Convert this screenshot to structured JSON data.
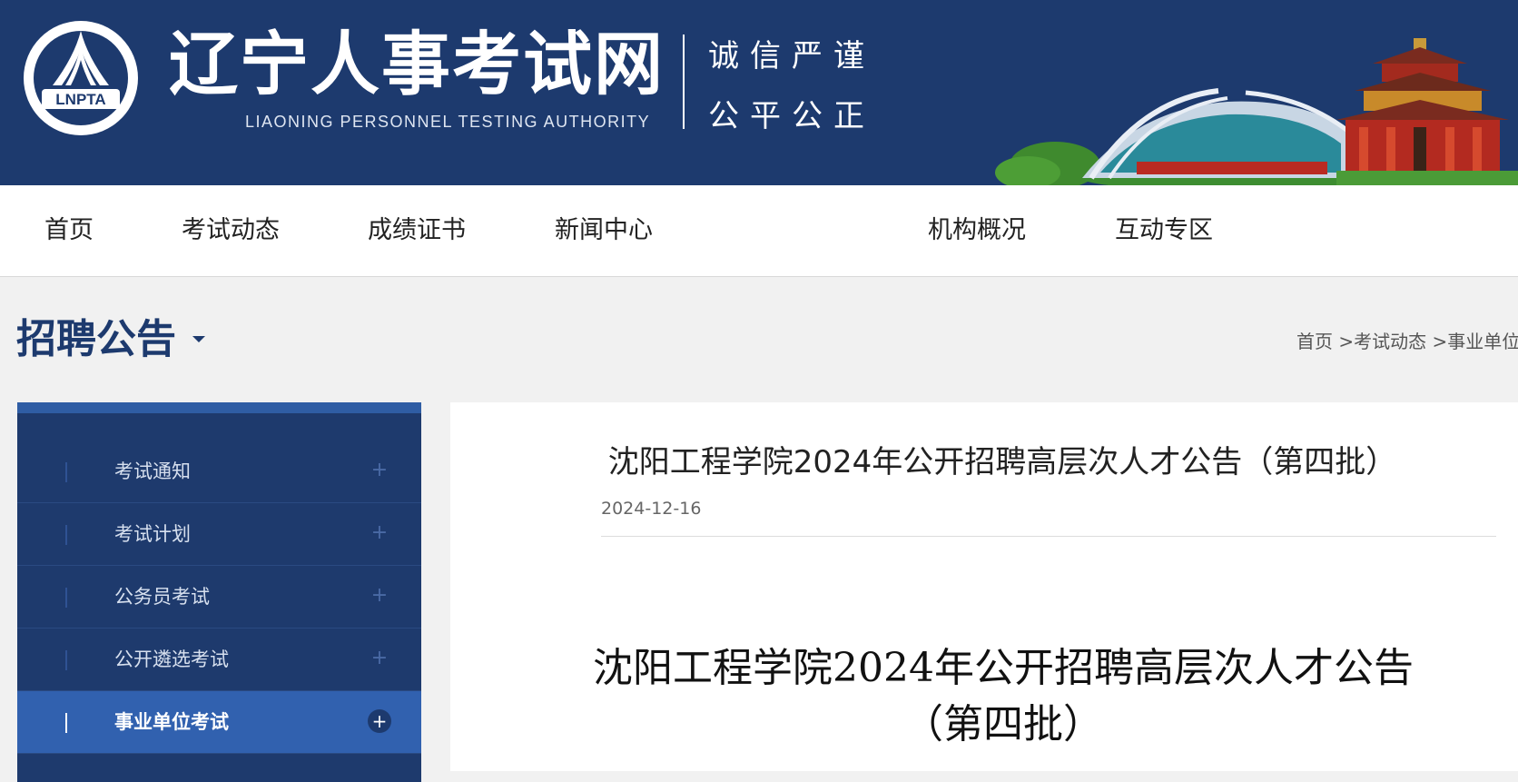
{
  "header": {
    "logo_text": "LNPTA",
    "site_title": "辽宁人事考试网",
    "site_subtitle": "LIAONING PERSONNEL TESTING AUTHORITY",
    "slogan_line1": "诚信严谨",
    "slogan_line2": "公平公正",
    "colors": {
      "banner_bg": "#1d3a6e",
      "text": "#ffffff"
    }
  },
  "nav": {
    "items": [
      {
        "label": "首页"
      },
      {
        "label": "考试动态"
      },
      {
        "label": "成绩证书"
      },
      {
        "label": "新闻中心"
      },
      {
        "label": "机构概况"
      },
      {
        "label": "互动专区"
      }
    ]
  },
  "section": {
    "title": "招聘公告"
  },
  "breadcrumb": {
    "text": "首页 >考试动态 >事业单位"
  },
  "sidebar": {
    "items": [
      {
        "label": "考试通知",
        "icon": "plus-icon",
        "active": false
      },
      {
        "label": "考试计划",
        "icon": "plus-icon",
        "active": false
      },
      {
        "label": "公务员考试",
        "icon": "plus-icon",
        "active": false
      },
      {
        "label": "公开遴选考试",
        "icon": "plus-icon",
        "active": false
      },
      {
        "label": "事业单位考试",
        "icon": "plus-circle-icon",
        "active": true
      }
    ],
    "plus_symbol": "+",
    "colors": {
      "bg": "#1e3a6d",
      "active_bg": "#3161af",
      "top_border": "#2f5da4"
    }
  },
  "article": {
    "title": "沈阳工程学院2024年公开招聘高层次人才公告（第四批）",
    "date": "2024-12-16",
    "doc_title_line1": "沈阳工程学院2024年公开招聘高层次人才公告",
    "doc_title_line2": "（第四批）"
  }
}
